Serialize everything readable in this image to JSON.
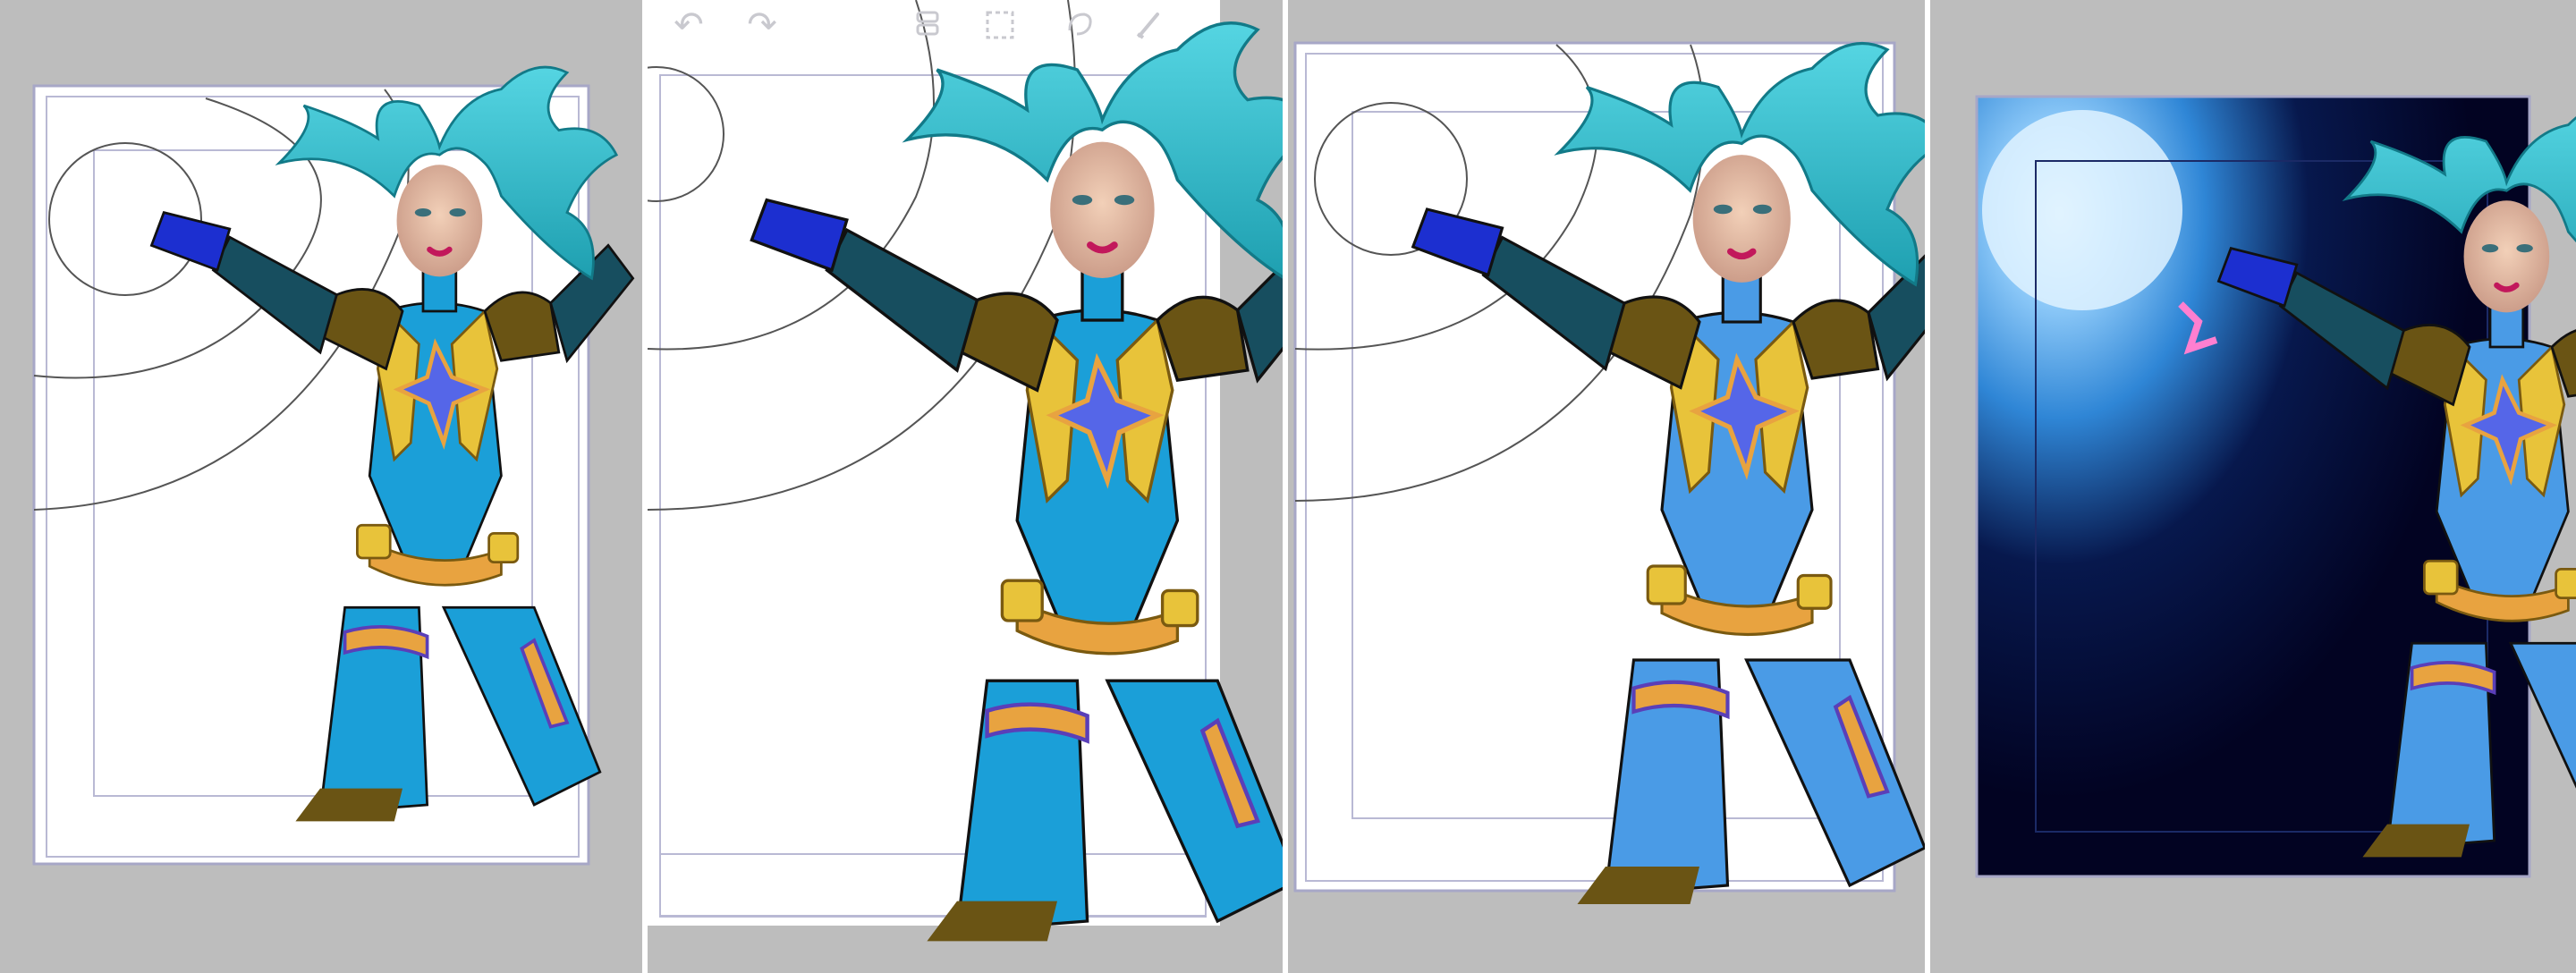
{
  "panels": [
    {
      "id": "step-1",
      "stage": "flat-colors"
    },
    {
      "id": "step-2",
      "stage": "zoomed-edit"
    },
    {
      "id": "step-3",
      "stage": "shaded"
    },
    {
      "id": "step-4",
      "stage": "final-background"
    }
  ],
  "toolbar_icons": [
    "undo-icon",
    "redo-icon",
    "layers-icon",
    "selection-icon",
    "lasso-icon",
    "brush-icon"
  ],
  "colors": {
    "frame_gray": "#bdbdbd",
    "hair": "#3cc4d4",
    "suit_blue": "#1b9fd8",
    "suit_light_blue": "#4a9be6",
    "gold": "#e8c33a",
    "dark_teal": "#174e5f",
    "olive": "#6a5414",
    "glove": "#1c2fd0",
    "night_bg": "#020322",
    "glow": "#cfeaff"
  }
}
